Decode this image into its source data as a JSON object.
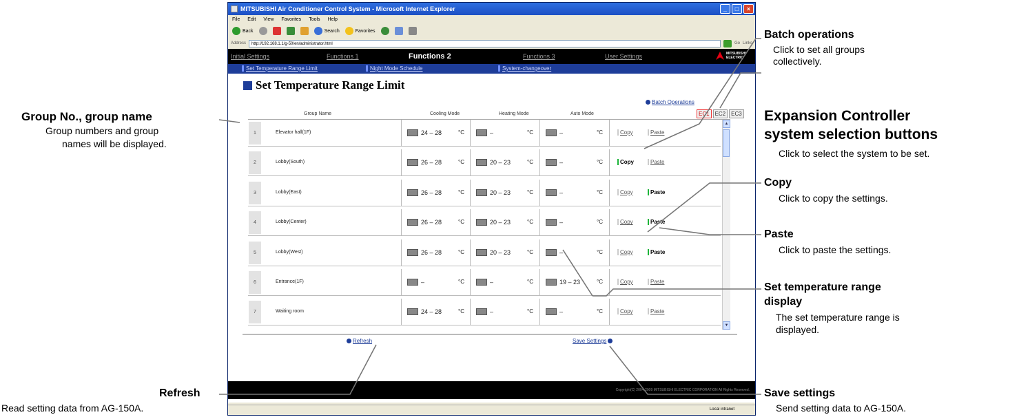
{
  "browser": {
    "title": "MITSUBISHI Air Conditioner Control System - Microsoft Internet Explorer",
    "menu": [
      "File",
      "Edit",
      "View",
      "Favorites",
      "Tools",
      "Help"
    ],
    "toolbar": {
      "back": "Back",
      "search": "Search",
      "favorites": "Favorites"
    },
    "address_label": "Address",
    "address": "http://192.168.1.1/g-50/en/administrator.html",
    "go": "Go",
    "links": "Links",
    "status_zone": "Local intranet"
  },
  "nav": {
    "functions": [
      "Initial Settings",
      "Functions 1",
      "Functions 2",
      "Functions 3",
      "User Settings"
    ],
    "active": "Functions 2",
    "brand": "MITSUBISHI ELECTRIC",
    "sub": [
      "Set Temperature Range Limit",
      "Night Mode Schedule",
      "System-changeover"
    ]
  },
  "page": {
    "title": "Set Temperature Range Limit",
    "batch_operations": "Batch Operations",
    "ec_buttons": [
      "EC1",
      "EC2",
      "EC3"
    ],
    "ec_selected": "EC1",
    "columns": [
      "Group Name",
      "Cooling Mode",
      "Heating Mode",
      "Auto Mode"
    ],
    "rows": [
      {
        "num": "1",
        "name": "Elevator hall(1F)",
        "cool": "24 – 28",
        "heat": "–",
        "auto": "–",
        "copy": "Copy",
        "paste": "Paste",
        "copy_active": false,
        "paste_active": false
      },
      {
        "num": "2",
        "name": "Lobby(South)",
        "cool": "26 – 28",
        "heat": "20 – 23",
        "auto": "–",
        "copy": "Copy",
        "paste": "Paste",
        "copy_active": true,
        "paste_active": false
      },
      {
        "num": "3",
        "name": "Lobby(East)",
        "cool": "26 – 28",
        "heat": "20 – 23",
        "auto": "–",
        "copy": "Copy",
        "paste": "Paste",
        "copy_active": false,
        "paste_active": true
      },
      {
        "num": "4",
        "name": "Lobby(Center)",
        "cool": "26 – 28",
        "heat": "20 – 23",
        "auto": "–",
        "copy": "Copy",
        "paste": "Paste",
        "copy_active": false,
        "paste_active": true
      },
      {
        "num": "5",
        "name": "Lobby(West)",
        "cool": "26 – 28",
        "heat": "20 – 23",
        "auto": "–",
        "copy": "Copy",
        "paste": "Paste",
        "copy_active": false,
        "paste_active": true
      },
      {
        "num": "6",
        "name": "Entrance(1F)",
        "cool": "–",
        "heat": "–",
        "auto": "19 – 23",
        "copy": "Copy",
        "paste": "Paste",
        "copy_active": false,
        "paste_active": false
      },
      {
        "num": "7",
        "name": "Waiting room",
        "cool": "24 – 28",
        "heat": "–",
        "auto": "–",
        "copy": "Copy",
        "paste": "Paste",
        "copy_active": false,
        "paste_active": false
      }
    ],
    "unit": "°C",
    "refresh": "Refresh",
    "save_settings": "Save Settings",
    "copyright": "Copyright(C) 2004-2009 MITSUBISHI ELECTRIC CORPORATION All Rights Reserved."
  },
  "callouts": {
    "batch": {
      "title": "Batch operations",
      "desc": "Click to set all groups\ncollectively."
    },
    "expansion": {
      "title1": "Expansion Controller",
      "title2": "system selection buttons",
      "desc": "Click to select the system to be set."
    },
    "group": {
      "title": "Group No., group name",
      "desc1": "Group numbers and group",
      "desc2": "names will be displayed."
    },
    "copy": {
      "title": "Copy",
      "desc": "Click to copy the settings."
    },
    "paste": {
      "title": "Paste",
      "desc": "Click to paste the settings."
    },
    "range": {
      "title1": "Set temperature range",
      "title2": "display",
      "desc1": "The set temperature range is",
      "desc2": "displayed."
    },
    "refresh": {
      "title": "Refresh",
      "desc": "Read setting data from AG-150A."
    },
    "save": {
      "title": "Save settings",
      "desc": "Send setting data to AG-150A."
    }
  }
}
